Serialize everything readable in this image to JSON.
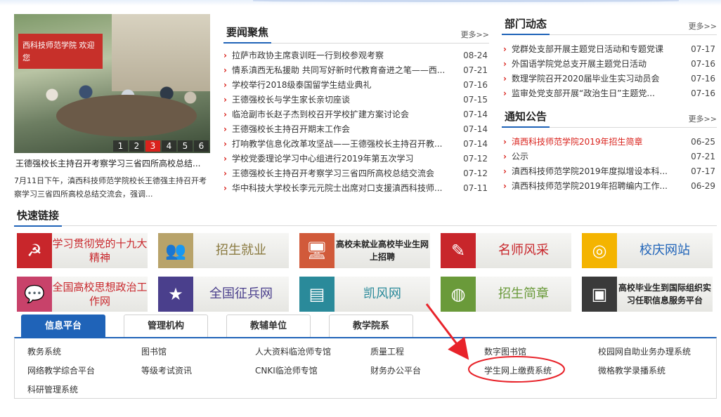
{
  "slider": {
    "pages": [
      "1",
      "2",
      "3",
      "4",
      "5",
      "6"
    ],
    "active_page": "3",
    "banner_text": "西科技师范学院 欢迎您",
    "caption": "王德强校长主持召开考察学习三省四所高校总结...",
    "description": "7月11日下午，滇西科技师范学院校长王德强主持召开考察学习三省四所高校总结交流会，强调..."
  },
  "headlines": {
    "title": "要闻聚焦",
    "more": "更多>>",
    "items": [
      {
        "title": "拉萨市政协主席袁训旺一行到校参观考察",
        "date": "08-24"
      },
      {
        "title": "情系滇西无私援助 共同写好新时代教育奋进之笔——西...",
        "date": "07-21"
      },
      {
        "title": "学校举行2018级泰国留学生结业典礼",
        "date": "07-16"
      },
      {
        "title": "王德强校长与学生家长亲切座谈",
        "date": "07-15"
      },
      {
        "title": "临沧副市长赵子杰到校召开学校扩建方案讨论会",
        "date": "07-14"
      },
      {
        "title": "王德强校长主持召开期末工作会",
        "date": "07-14"
      },
      {
        "title": "打响教学信息化改革攻坚战——王德强校长主持召开教...",
        "date": "07-14"
      },
      {
        "title": "学校党委理论学习中心组进行2019年第五次学习",
        "date": "07-12"
      },
      {
        "title": "王德强校长主持召开考察学习三省四所高校总结交流会",
        "date": "07-12"
      },
      {
        "title": "华中科技大学校长李元元院士出席对口支援滇西科技师...",
        "date": "07-11"
      }
    ]
  },
  "departments": {
    "title": "部门动态",
    "more": "更多>>",
    "items": [
      {
        "title": "党群处支部开展主题党日活动和专题党课",
        "date": "07-17"
      },
      {
        "title": "外国语学院党总支开展主题党日活动",
        "date": "07-16"
      },
      {
        "title": "数理学院召开2020届毕业生实习动员会",
        "date": "07-16"
      },
      {
        "title": "监审处党支部开展“政治生日”主题党...",
        "date": "07-16"
      }
    ]
  },
  "notices": {
    "title": "通知公告",
    "more": "更多>>",
    "items": [
      {
        "title": "滇西科技师范学院2019年招生简章",
        "date": "06-25",
        "highlight": true
      },
      {
        "title": "公示",
        "date": "07-21",
        "highlight": false
      },
      {
        "title": "滇西科技师范学院2019年度拟增设本科...",
        "date": "07-17",
        "highlight": false
      },
      {
        "title": "滇西科技师范学院2019年招聘编内工作...",
        "date": "06-29",
        "highlight": false
      }
    ]
  },
  "quick_links": {
    "title": "快速链接",
    "row1": [
      {
        "label": "学习贯彻党的十九大精神",
        "icon": "party-emblem-icon",
        "color": "#c8262b",
        "text_color": "#c8262b"
      },
      {
        "label": "招生就业",
        "icon": "people-icon",
        "color": "#b8a36a",
        "text_color": "#8a7a40"
      },
      {
        "label": "高校未就业高校毕业生网上招聘",
        "icon": "monitor-icon",
        "color": "#d15a3a",
        "text_color": "#222"
      },
      {
        "label": "名师风采",
        "icon": "pen-note-icon",
        "color": "#c8262b",
        "text_color": "#c8262b"
      },
      {
        "label": "校庆网站",
        "icon": "anniversary-logo-icon",
        "color": "#f4b400",
        "text_color": "#1f63b8"
      }
    ],
    "row2": [
      {
        "label": "全国高校思想政治工作网",
        "icon": "speech-bubble-icon",
        "color": "#c8426a",
        "text_color": "#c8262b"
      },
      {
        "label": "全国征兵网",
        "icon": "star-icon",
        "color": "#4a3f8c",
        "text_color": "#4a3f8c"
      },
      {
        "label": "凯风网",
        "icon": "news-icon",
        "color": "#2a8a9a",
        "text_color": "#2a8a9a"
      },
      {
        "label": "招生简章",
        "icon": "globe-icon",
        "color": "#6a9a3a",
        "text_color": "#6a9a3a"
      },
      {
        "label": "高校毕业生到国际组织实习任职信息服务平台",
        "icon": "chat-icon",
        "color": "#3a3a3a",
        "text_color": "#222"
      }
    ]
  },
  "tabs": {
    "items": [
      "信息平台",
      "管理机构",
      "教辅单位",
      "教学院系"
    ],
    "active": "信息平台"
  },
  "systems": {
    "row1": [
      "教务系统",
      "图书馆",
      "人大资料临沧师专馆",
      "质量工程",
      "数字图书馆",
      "校园网自助业务办理系统"
    ],
    "row2": [
      "网络教学综合平台",
      "等级考试资讯",
      "CNKI临沧师专馆",
      "财务办公平台",
      "学生网上缴费系统",
      "微格教学录播系统"
    ],
    "row3": [
      "科研管理系统"
    ]
  },
  "colors": {
    "accent": "#1f63b8",
    "bullet": "#d9221c",
    "annotation": "#e8232a"
  }
}
